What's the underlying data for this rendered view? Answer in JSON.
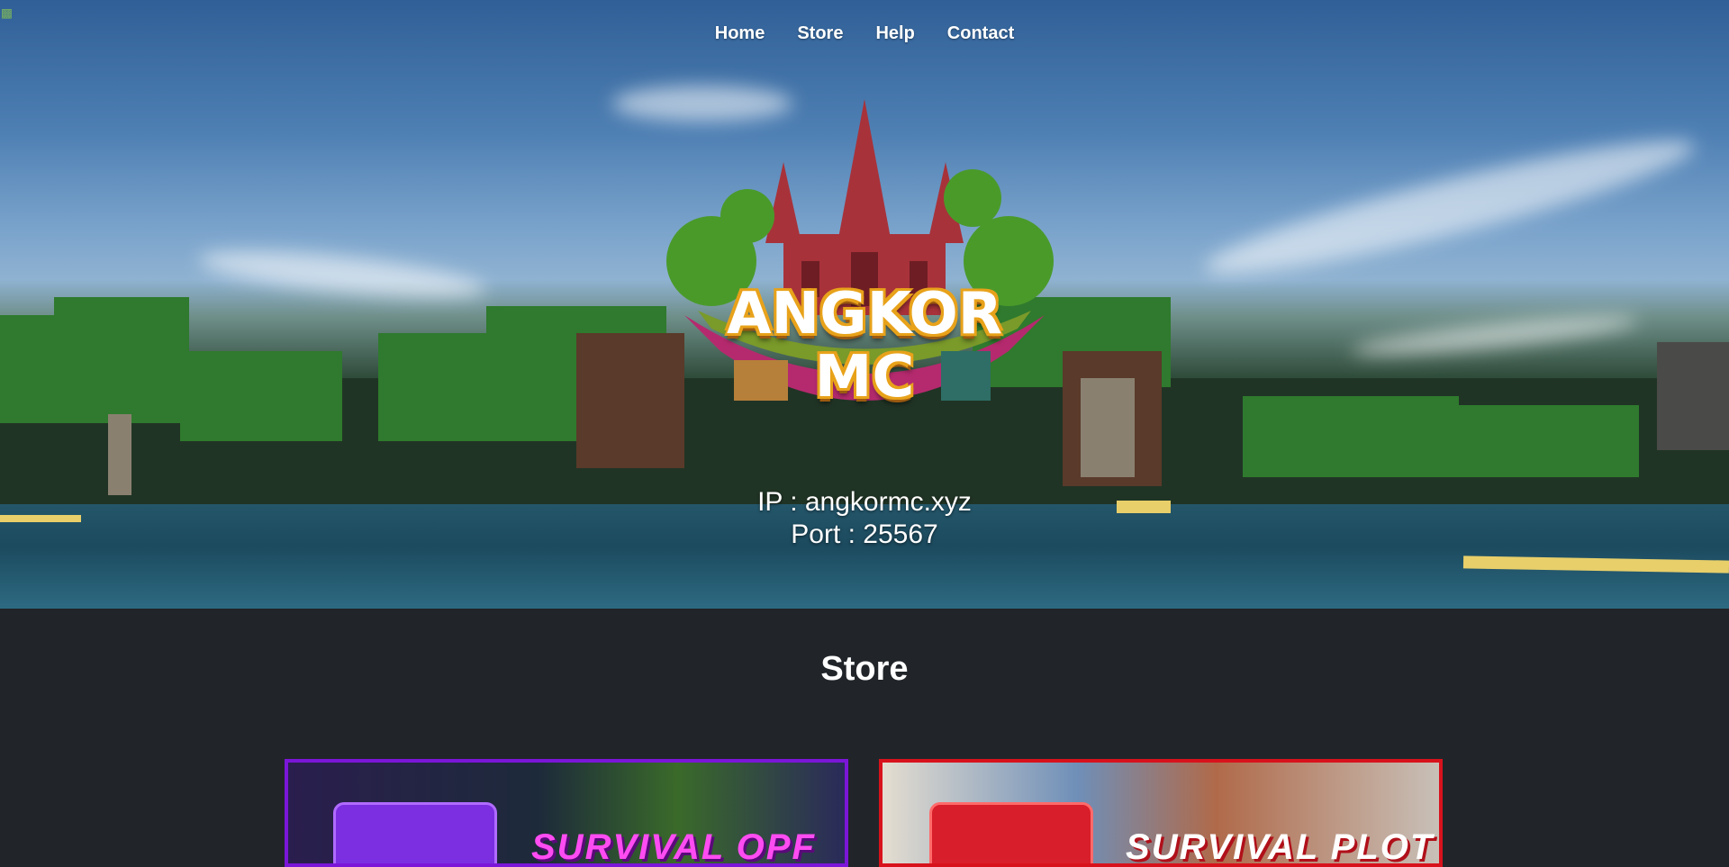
{
  "nav": {
    "items": [
      {
        "label": "Home"
      },
      {
        "label": "Store"
      },
      {
        "label": "Help"
      },
      {
        "label": "Contact"
      }
    ]
  },
  "hero": {
    "logo_line1": "ANGKOR",
    "logo_line2": "MC",
    "ip_line": "IP : angkormc.xyz",
    "port_line": "Port : 25567"
  },
  "store": {
    "title": "Store",
    "cards": [
      {
        "label": "SURVIVAL OPF",
        "border_color": "#7b16d8",
        "text_color": "#ff4cf2"
      },
      {
        "label": "SURVIVAL PLOT",
        "border_color": "#d8121c",
        "text_color": "#ffffff"
      }
    ]
  },
  "colors": {
    "page_background": "#212529",
    "logo_gold": "#e8a21a"
  }
}
